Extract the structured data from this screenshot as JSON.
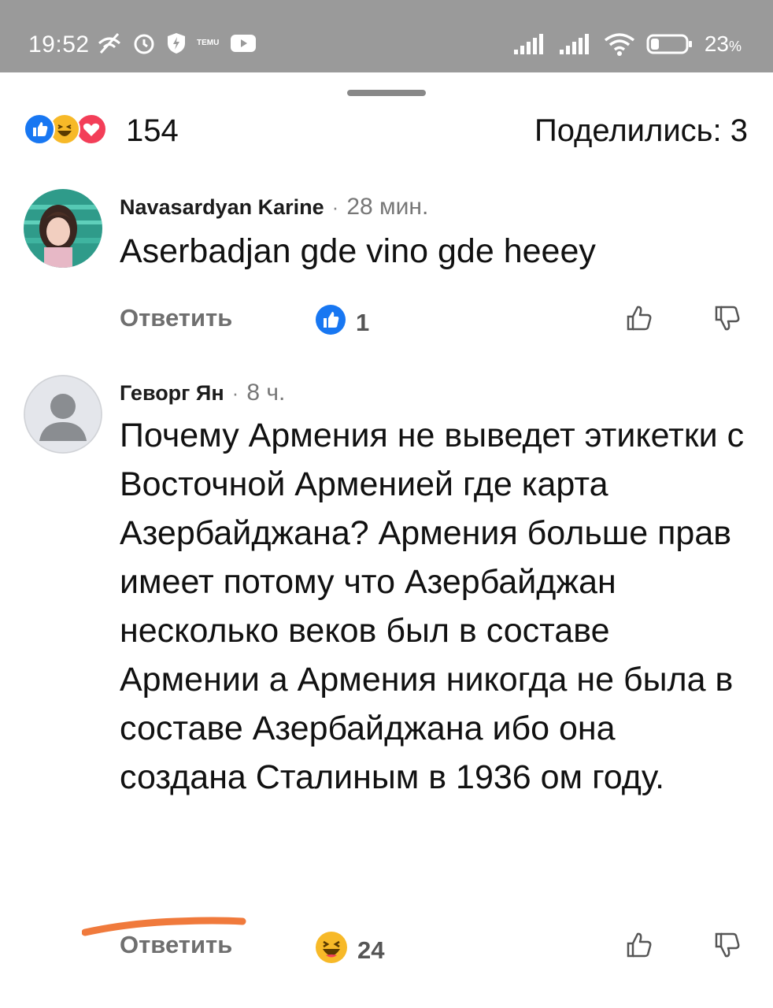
{
  "status_bar": {
    "time": "19:52",
    "battery_percent": "23",
    "battery_suffix": "%",
    "temu_label": "TEMU",
    "icons_left": [
      "wifi-off-icon",
      "alarm-icon",
      "shield-bolt-icon",
      "temu-app-icon",
      "youtube-icon"
    ],
    "icons_right": [
      "signal-bars-icon",
      "signal-bars-icon",
      "wifi-icon",
      "battery-icon"
    ]
  },
  "summary": {
    "reactions": [
      "like-icon",
      "haha-icon",
      "love-icon"
    ],
    "count": "154",
    "shares_label": "Поделились: 3"
  },
  "comments": [
    {
      "author": "Navasardyan Karine",
      "separator": "·",
      "time": "28 мин.",
      "text": "Aserbadjan gde vino gde heeey",
      "reply_label": "Ответить",
      "reaction_icon": "like-icon",
      "reaction_count": "1"
    },
    {
      "author": "Геворг Ян",
      "separator": "·",
      "time": "8 ч.",
      "text": "Почему Армения не выведет этикетки с Восточной Арменией где карта Азербайджана? Армения больше прав имеет потому что Азербайджан несколько веков был в составе Армении а Армения никогда не была в составе Азербайджана ибо она создана Сталиным в 1936 ом году.",
      "reply_label": "Ответить",
      "reaction_icon": "haha-icon",
      "reaction_count": "24"
    }
  ],
  "colors": {
    "status_bar": "#9a9a9a",
    "like_blue": "#1877f2",
    "love_red": "#f33e58",
    "haha_yellow": "#f7b928",
    "highlight_orange": "#f07a3c"
  }
}
